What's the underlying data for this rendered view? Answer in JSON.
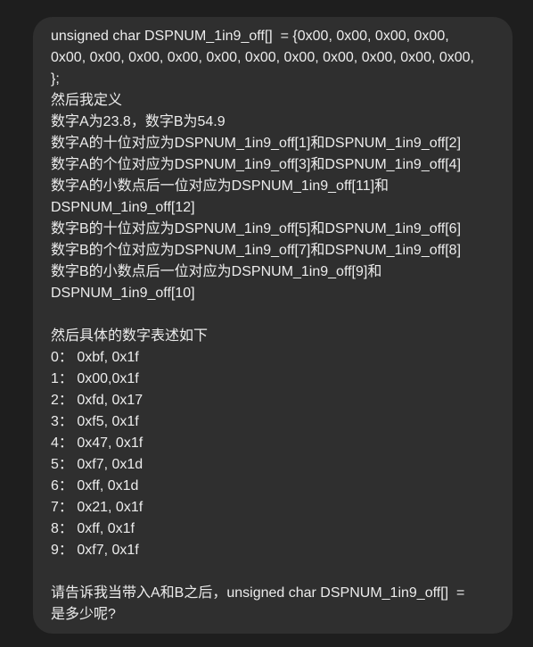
{
  "message": {
    "lines": [
      "unsigned char DSPNUM_1in9_off[]  = {0x00, 0x00, 0x00, 0x00,",
      "0x00, 0x00, 0x00, 0x00, 0x00, 0x00, 0x00, 0x00, 0x00, 0x00, 0x00,",
      "};",
      "然后我定义",
      "数字A为23.8，数字B为54.9",
      "数字A的十位对应为DSPNUM_1in9_off[1]和DSPNUM_1in9_off[2]",
      "数字A的个位对应为DSPNUM_1in9_off[3]和DSPNUM_1in9_off[4]",
      "数字A的小数点后一位对应为DSPNUM_1in9_off[11]和",
      "DSPNUM_1in9_off[12]",
      "数字B的十位对应为DSPNUM_1in9_off[5]和DSPNUM_1in9_off[6]",
      "数字B的个位对应为DSPNUM_1in9_off[7]和DSPNUM_1in9_off[8]",
      "数字B的小数点后一位对应为DSPNUM_1in9_off[9]和",
      "DSPNUM_1in9_off[10]",
      "",
      "然后具体的数字表述如下",
      "0： 0xbf, 0x1f",
      "1： 0x00,0x1f",
      "2： 0xfd, 0x17",
      "3： 0xf5, 0x1f",
      "4： 0x47, 0x1f",
      "5： 0xf7, 0x1d",
      "6： 0xff, 0x1d",
      "7： 0x21, 0x1f",
      "8： 0xff, 0x1f",
      "9： 0xf7, 0x1f",
      "",
      "请告诉我当带入A和B之后，unsigned char DSPNUM_1in9_off[]  =",
      "是多少呢?"
    ]
  },
  "colors": {
    "page_background": "#1e1e1e",
    "bubble_background": "#2f2f2f",
    "text": "#ececec"
  }
}
